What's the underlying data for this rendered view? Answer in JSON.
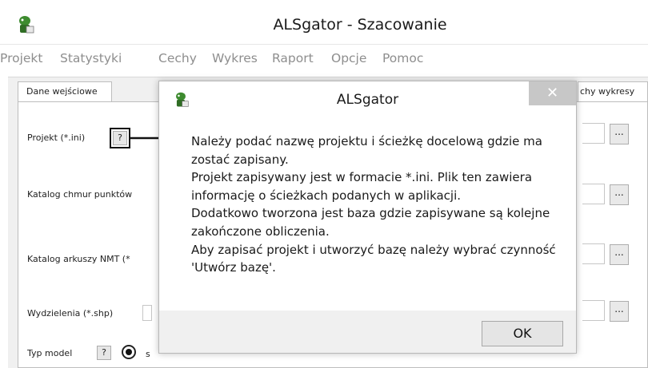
{
  "window": {
    "title": "ALSgator - Szacowanie",
    "icon": "alsgator-logo-icon"
  },
  "menu": [
    "Projekt",
    "Statystyki",
    "Cechy",
    "Wykres",
    "Raport",
    "Opcje",
    "Pomoc"
  ],
  "tabs": {
    "active": "Dane wejściowe",
    "partial_right": "chy wykresy"
  },
  "form": {
    "project_label": "Projekt (*.ini)",
    "point_cloud_label": "Katalog chmur punktów",
    "dtm_label": "Katalog arkuszy NMT (*",
    "regions_label": "Wydzielenia (*.shp)",
    "model_type_label": "Typ model",
    "help_label": "?",
    "browse_label": "...",
    "radio_partial": "s"
  },
  "dialog": {
    "title": "ALSgator",
    "close_label": "✕",
    "message": "Należy podać nazwę projektu i ścieżkę docelową gdzie ma zostać zapisany.\nProjekt zapisywany jest w formacie *.ini. Plik ten zawiera informację o ścieżkach podanych w aplikacji.\nDodatkowo tworzona jest baza gdzie zapisywane są kolejne zakończone obliczenia.\nAby zapisać projekt i utworzyć bazę należy wybrać czynność 'Utwórz bazę'.",
    "ok_label": "OK"
  },
  "colors": {
    "menu_text": "#8e8e8e",
    "dialog_bg": "#f0f0f0",
    "close_bg": "#c7c7c7"
  }
}
